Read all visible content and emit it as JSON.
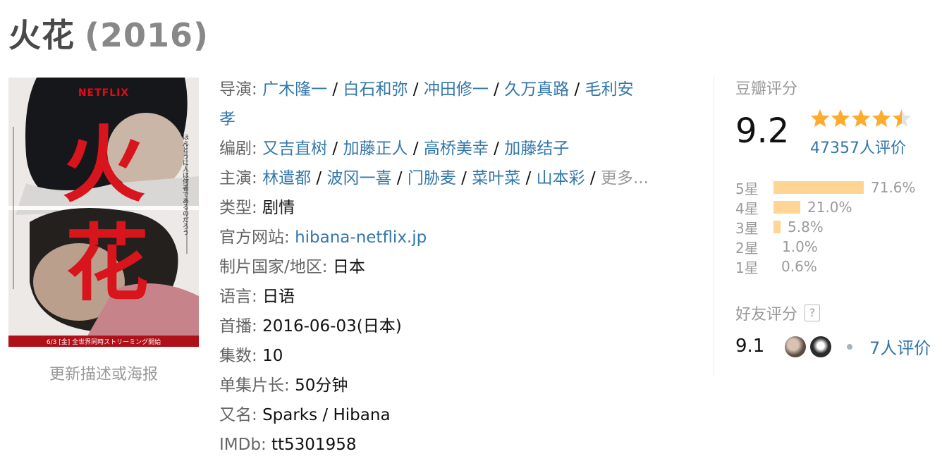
{
  "title": {
    "name": "火花",
    "year": "(2016)"
  },
  "poster": {
    "brand_text": "NETFLIX",
    "title_char_1": "火",
    "title_char_2": "花",
    "side_text": "ほんとうに人は何者であるのだろう",
    "band_text": "6/3 [金] 全世界同時ストリーミング開始",
    "update_link": "更新描述或海报"
  },
  "info": {
    "director": {
      "label": "导演:",
      "names": [
        "广木隆一",
        "白石和弥",
        "冲田修一",
        "久万真路",
        "毛利安"
      ],
      "wrap": "孝"
    },
    "writer": {
      "label": "编剧:",
      "names": [
        "又吉直树",
        "加藤正人",
        "高桥美幸",
        "加藤结子"
      ]
    },
    "cast": {
      "label": "主演:",
      "names": [
        "林遣都",
        "波冈一喜",
        "门胁麦",
        "菜叶菜",
        "山本彩"
      ],
      "more": "更多..."
    },
    "genre": {
      "label": "类型:",
      "value": "剧情"
    },
    "website": {
      "label": "官方网站:",
      "value": "hibana-netflix.jp"
    },
    "country": {
      "label": "制片国家/地区:",
      "value": "日本"
    },
    "language": {
      "label": "语言:",
      "value": "日语"
    },
    "premiere": {
      "label": "首播:",
      "value": "2016-06-03(日本)"
    },
    "episodes": {
      "label": "集数:",
      "value": "10"
    },
    "runtime": {
      "label": "单集片长:",
      "value": "50分钟"
    },
    "aka": {
      "label": "又名:",
      "value": "Sparks / Hibana"
    },
    "imdb": {
      "label": "IMDb:",
      "value": "tt5301958"
    }
  },
  "rating": {
    "label": "豆瓣评分",
    "score": "9.2",
    "stars": 4.5,
    "count": "47357人评价",
    "distribution": [
      {
        "label": "5星",
        "percent": 71.6,
        "text": "71.6%"
      },
      {
        "label": "4星",
        "percent": 21.0,
        "text": "21.0%"
      },
      {
        "label": "3星",
        "percent": 5.8,
        "text": "5.8%"
      },
      {
        "label": "2星",
        "percent": 1.0,
        "text": "1.0%"
      },
      {
        "label": "1星",
        "percent": 0.6,
        "text": "0.6%"
      }
    ],
    "star_color": "#ffac2d",
    "bar_color": "#ffd596"
  },
  "friends": {
    "label": "好友评分",
    "help": "?",
    "score": "9.1",
    "count": "7人评价"
  },
  "colors": {
    "link": "#3377aa",
    "label": "#666666",
    "muted": "#999999"
  }
}
